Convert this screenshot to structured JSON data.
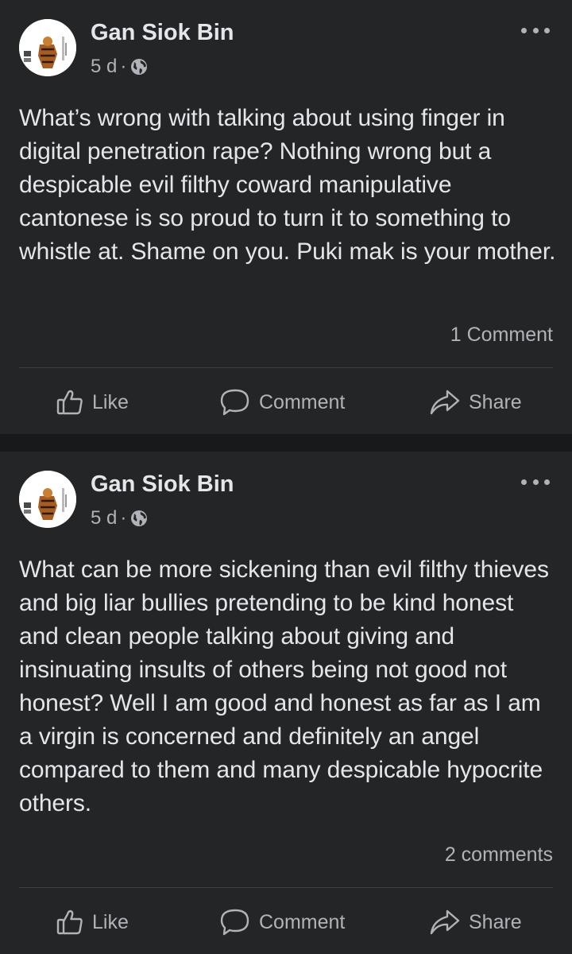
{
  "posts": [
    {
      "author": "Gan Siok Bin",
      "time": "5 d",
      "separator": "·",
      "privacy_icon": "globe-icon",
      "text": "What’s wrong with talking about using finger in digital penetration rape? Nothing wrong but a despicable evil filthy coward manipulative cantonese is so proud to turn it to something to whistle at. Shame on you. Puki mak is your mother.",
      "comment_count": "1 Comment",
      "actions": {
        "like": "Like",
        "comment": "Comment",
        "share": "Share"
      }
    },
    {
      "author": "Gan Siok Bin",
      "time": "5 d",
      "separator": "·",
      "privacy_icon": "globe-icon",
      "text": "What can be more sickening than evil filthy thieves and big liar bullies pretending to be kind honest and clean people talking about giving and insinuating insults of others being not good not honest? Well I am good and honest as far as I am a virgin is concerned and definitely an angel compared to them and many despicable hypocrite others.",
      "comment_count": "2 comments",
      "actions": {
        "like": "Like",
        "comment": "Comment",
        "share": "Share"
      }
    }
  ],
  "colors": {
    "background": "#18191a",
    "card": "#242526",
    "primary_text": "#e4e6eb",
    "secondary_text": "#b0b3b8",
    "divider": "#3e4042"
  }
}
